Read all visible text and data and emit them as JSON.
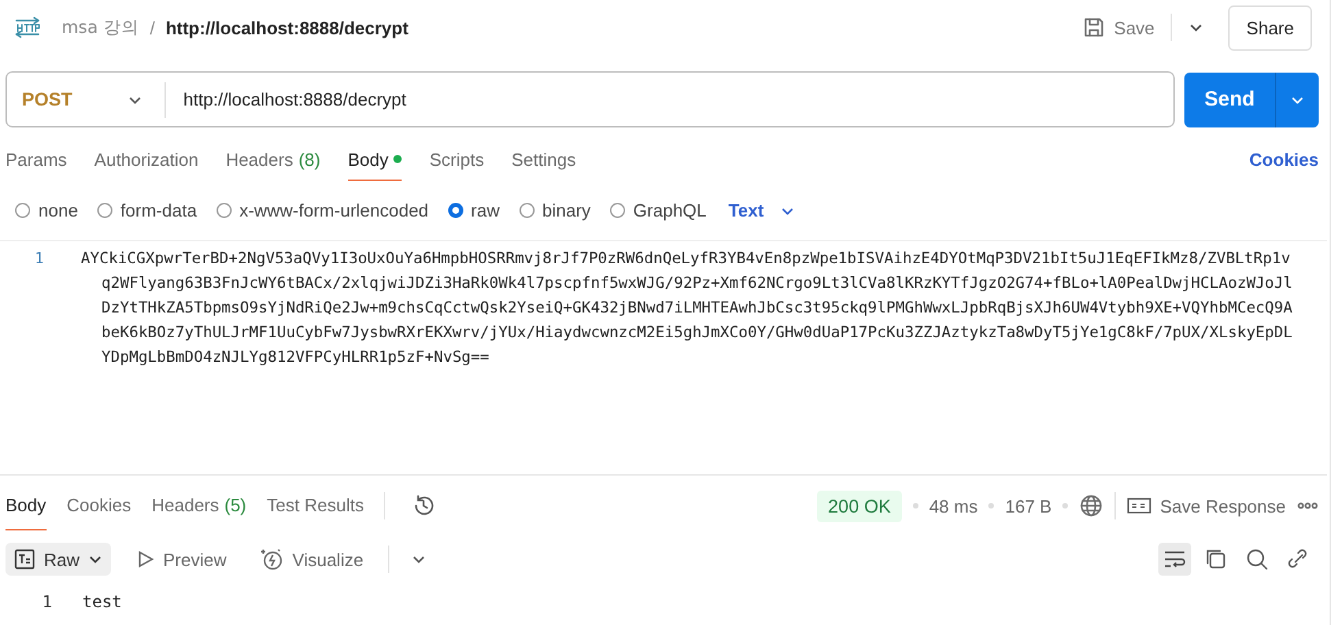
{
  "breadcrumb": {
    "collection": "msa 강의",
    "separator": "/",
    "request": "http://localhost:8888/decrypt"
  },
  "header_actions": {
    "save": "Save",
    "share": "Share"
  },
  "request": {
    "method": "POST",
    "url": "http://localhost:8888/decrypt",
    "send": "Send"
  },
  "request_tabs": [
    {
      "label": "Params",
      "dot": false,
      "selected": false
    },
    {
      "label": "Authorization",
      "dot": false,
      "selected": false
    },
    {
      "label": "Headers",
      "count": "(8)",
      "dot": false,
      "selected": false
    },
    {
      "label": "Body",
      "dot": true,
      "selected": true
    },
    {
      "label": "Scripts",
      "dot": false,
      "selected": false
    },
    {
      "label": "Settings",
      "dot": false,
      "selected": false
    }
  ],
  "cookies_link": "Cookies",
  "body_types": [
    {
      "label": "none",
      "selected": false
    },
    {
      "label": "form-data",
      "selected": false
    },
    {
      "label": "x-www-form-urlencoded",
      "selected": false
    },
    {
      "label": "raw",
      "selected": true
    },
    {
      "label": "binary",
      "selected": false
    },
    {
      "label": "GraphQL",
      "selected": false
    }
  ],
  "raw_format": "Text",
  "request_body": [
    {
      "line": "1",
      "text": "AYCkiCGXpwrTerBD+2NgV53aQVy1I3oUxOuYa6HmpbHOSRRmvj8rJf7P0zRW6dnQeLyfR3YB4vEn8pzWpe1bISVAihzE4DYOtMqP3DV21bIt5uJ1EqEFIkMz8/ZVBLtRp1vq2WFlyang63B3FnJcWY6tBACx/2xlqjwiJDZi3HaRk0Wk4l7pscpfnf5wxWJG/92Pz+Xmf62NCrgo9Lt3lCVa8lKRzKYTfJgzO2G74+fBLo+lA0PealDwjHCLAozWJoJlDzYtTHkZA5TbpmsO9sYjNdRiQe2Jw+m9chsCqCctwQsk2YseiQ+GK432jBNwd7iLMHTEAwhJbCsc3t95ckq9lPMGhWwxLJpbRqBjsXJh6UW4Vtybh9XE+VQYhbMCecQ9AbeK6kBOz7yThULJrMF1UuCybFw7JysbwRXrEKXwrv/jYUx/HiaydwcwnzcM2Ei5ghJmXCo0Y/GHw0dUaP17PcKu3ZZJAztykzTa8wDyT5jYe1gC8kF/7pUX/XLskyEpDLYDpMgLbBmDO4zNJLYg812VFPCyHLRR1p5zF+NvSg=="
    }
  ],
  "response_tabs": [
    {
      "label": "Body",
      "selected": true
    },
    {
      "label": "Cookies",
      "selected": false
    },
    {
      "label": "Headers",
      "count": "(5)",
      "selected": false
    },
    {
      "label": "Test Results",
      "selected": false
    }
  ],
  "response_meta": {
    "status": "200 OK",
    "time": "48 ms",
    "size": "167 B",
    "save_response": "Save Response"
  },
  "response_views": [
    {
      "label": "Raw",
      "kind": "dropdown",
      "selected": true
    },
    {
      "label": "Preview",
      "kind": "preview",
      "selected": false
    },
    {
      "label": "Visualize",
      "kind": "visualize",
      "selected": false
    }
  ],
  "response_body": [
    {
      "line": "1",
      "text": "test"
    }
  ]
}
